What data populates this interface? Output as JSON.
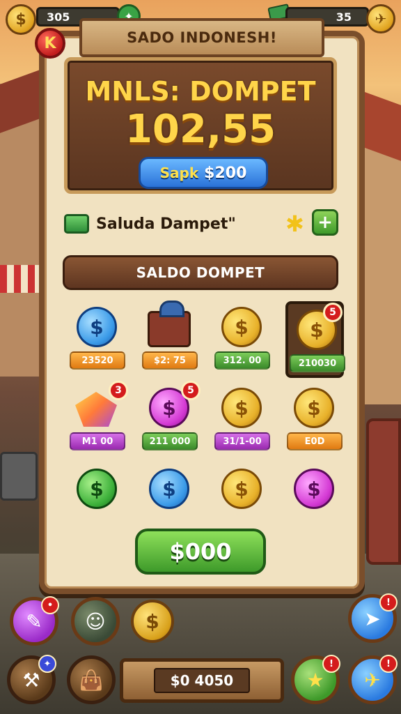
{
  "hud": {
    "left_value": "305",
    "right_value": "35",
    "coin_symbol": "$"
  },
  "panel": {
    "close_label": "K",
    "title": "SADO INDONESH!",
    "wallet_title": "MNLS: DOMPET",
    "wallet_amount": "102,55",
    "wallet_button_prefix": "Sapk",
    "wallet_button_value": "$200",
    "balance_label": "Saluda Dampet\"",
    "section_title": "SALDO DOMPET"
  },
  "items": [
    {
      "kind": "coin-blue",
      "price": "23520",
      "price_color": "orange",
      "badge": ""
    },
    {
      "kind": "cart",
      "price": "$2: 75",
      "price_color": "orange",
      "badge": ""
    },
    {
      "kind": "coin-gold",
      "price": "312. 00",
      "price_color": "green",
      "badge": ""
    },
    {
      "kind": "coin-gold",
      "price": "210030",
      "price_color": "green",
      "badge": "5",
      "selected": true
    },
    {
      "kind": "gem",
      "price": "M1 00",
      "price_color": "purple",
      "badge": "3"
    },
    {
      "kind": "coin-pink",
      "price": "211 000",
      "price_color": "green",
      "badge": "5"
    },
    {
      "kind": "coin-gold",
      "price": "31/1-00",
      "price_color": "purple",
      "badge": ""
    },
    {
      "kind": "coin-gold",
      "price": "E0D",
      "price_color": "orange",
      "badge": ""
    },
    {
      "kind": "coin-green",
      "price": "",
      "price_color": "",
      "badge": ""
    },
    {
      "kind": "coin-blue",
      "price": "",
      "price_color": "",
      "badge": ""
    },
    {
      "kind": "coin-gold",
      "price": "",
      "price_color": "",
      "badge": ""
    },
    {
      "kind": "coin-pink",
      "price": "",
      "price_color": "",
      "badge": ""
    }
  ],
  "buy_button": "$000",
  "bottom": {
    "plank_value": "$0 4050",
    "badge_left_top": "",
    "badge_blue": "!",
    "badge_green": "!",
    "badge_right": "!"
  },
  "colors": {
    "panel_bg": "#f1e2c1",
    "frame": "#7a4e2b",
    "accent_gold": "#ffd54a",
    "buy_green": "#3e9a2a"
  }
}
